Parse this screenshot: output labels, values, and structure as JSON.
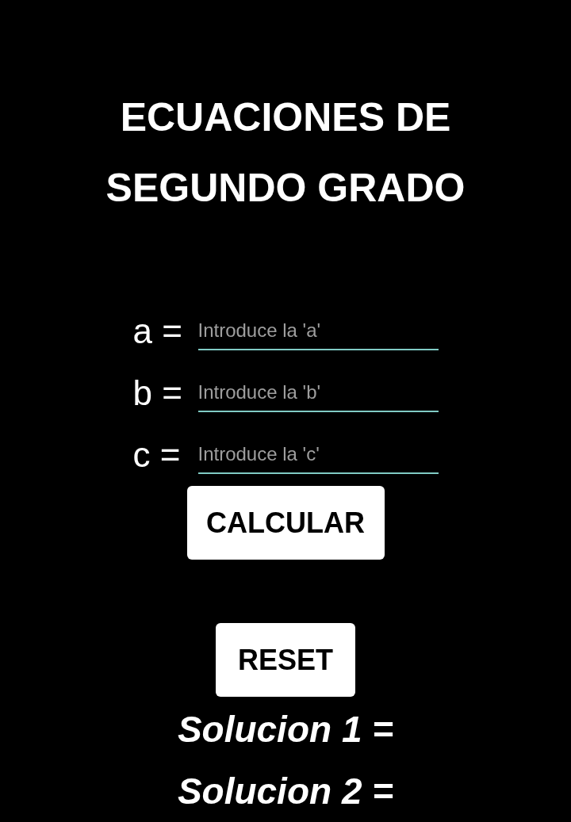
{
  "title": "ECUACIONES DE SEGUNDO GRADO",
  "fields": [
    {
      "label": "a =",
      "placeholder": "Introduce la 'a'"
    },
    {
      "label": "b =",
      "placeholder": "Introduce la 'b'"
    },
    {
      "label": "c =",
      "placeholder": "Introduce la 'c'"
    }
  ],
  "calculate_button": "CALCULAR",
  "reset_button": "RESET",
  "solutions": [
    "Solucion 1 =",
    "Solucion 2 ="
  ]
}
